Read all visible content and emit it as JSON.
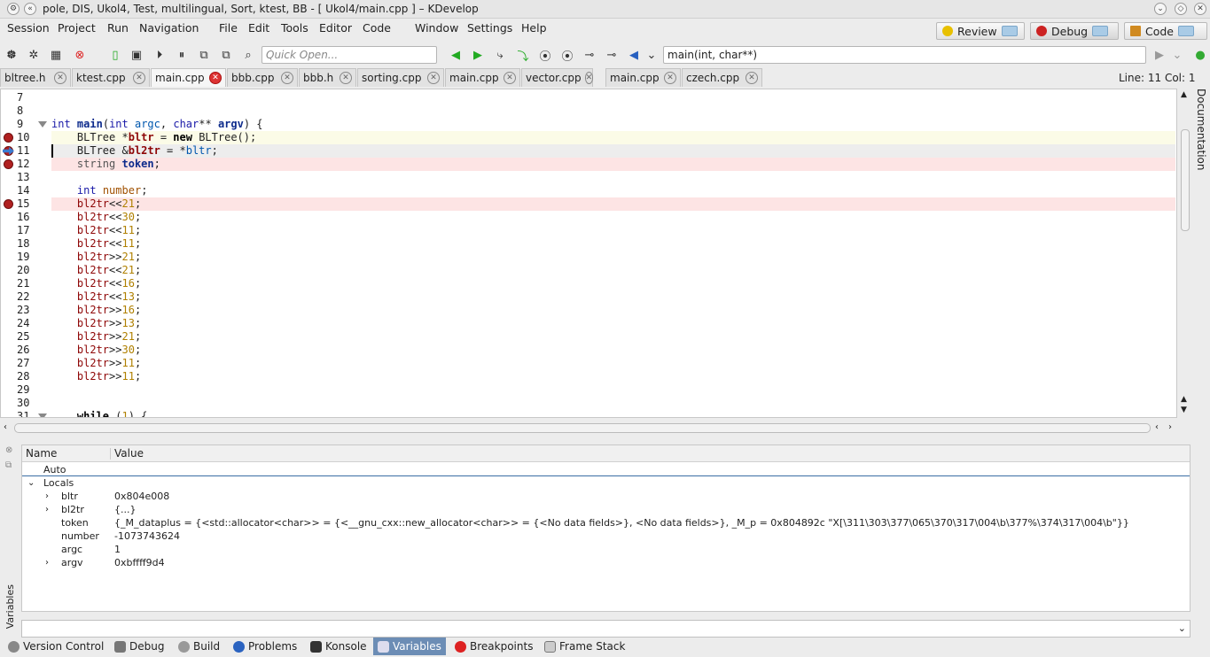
{
  "window": {
    "title": "pole, DIS, Ukol4, Test, multilingual, Sort, ktest, BB - [ Ukol4/main.cpp ] – KDevelop"
  },
  "menu": [
    "Session",
    "Project",
    "Run",
    "Navigation",
    "File",
    "Edit",
    "Tools",
    "Editor",
    "Code",
    "Window",
    "Settings",
    "Help"
  ],
  "modes": {
    "review": "Review",
    "debug": "Debug",
    "code": "Code"
  },
  "toolbar": {
    "quick_open_placeholder": "Quick Open...",
    "context": "main(int, char**)"
  },
  "tabs": [
    "bltree.h",
    "ktest.cpp",
    "main.cpp",
    "bbb.cpp",
    "bbb.h",
    "sorting.cpp",
    "main.cpp",
    "vector.cpp",
    "main.cpp",
    "czech.cpp"
  ],
  "status": {
    "line_col": "Line: 11 Col: 1"
  },
  "doc_panel": "Documentation",
  "editor": {
    "lines": [
      {
        "n": "7",
        "bp": false,
        "cur": false,
        "fold": false
      },
      {
        "n": "8",
        "bp": false,
        "cur": false,
        "fold": false
      },
      {
        "n": "9",
        "bp": false,
        "cur": false,
        "fold": true
      },
      {
        "n": "10",
        "bp": true,
        "cur": false,
        "fold": false
      },
      {
        "n": "11",
        "bp": true,
        "cur": true,
        "fold": false
      },
      {
        "n": "12",
        "bp": true,
        "cur": false,
        "fold": false
      },
      {
        "n": "13",
        "bp": false,
        "cur": false,
        "fold": false
      },
      {
        "n": "14",
        "bp": false,
        "cur": false,
        "fold": false
      },
      {
        "n": "15",
        "bp": true,
        "cur": false,
        "fold": false
      },
      {
        "n": "16"
      },
      {
        "n": "17"
      },
      {
        "n": "18"
      },
      {
        "n": "19"
      },
      {
        "n": "20"
      },
      {
        "n": "21"
      },
      {
        "n": "22"
      },
      {
        "n": "23"
      },
      {
        "n": "24"
      },
      {
        "n": "25"
      },
      {
        "n": "26"
      },
      {
        "n": "27"
      },
      {
        "n": "28"
      },
      {
        "n": "29"
      },
      {
        "n": "30"
      },
      {
        "n": "31",
        "fold": true
      }
    ]
  },
  "variables": {
    "columns": {
      "name": "Name",
      "value": "Value"
    },
    "auto": "Auto",
    "locals": "Locals",
    "rows": [
      {
        "name": "bltr",
        "value": "0x804e008",
        "expand": true
      },
      {
        "name": "bl2tr",
        "value": "{...}",
        "expand": true
      },
      {
        "name": "token",
        "value": "{_M_dataplus = {<std::allocator<char>> = {<__gnu_cxx::new_allocator<char>> = {<No data fields>}, <No data fields>}, _M_p = 0x804892c \"X[\\311\\303\\377\\065\\370\\317\\004\\b\\377%\\374\\317\\004\\b\"}}",
        "expand": false
      },
      {
        "name": "number",
        "value": "-1073743624",
        "expand": false
      },
      {
        "name": "argc",
        "value": "1",
        "expand": false
      },
      {
        "name": "argv",
        "value": "0xbffff9d4",
        "expand": true
      }
    ],
    "side_label": "Variables"
  },
  "bottom_tabs": [
    "Version Control",
    "Debug",
    "Build",
    "Problems",
    "Konsole",
    "Variables",
    "Breakpoints",
    "Frame Stack"
  ]
}
